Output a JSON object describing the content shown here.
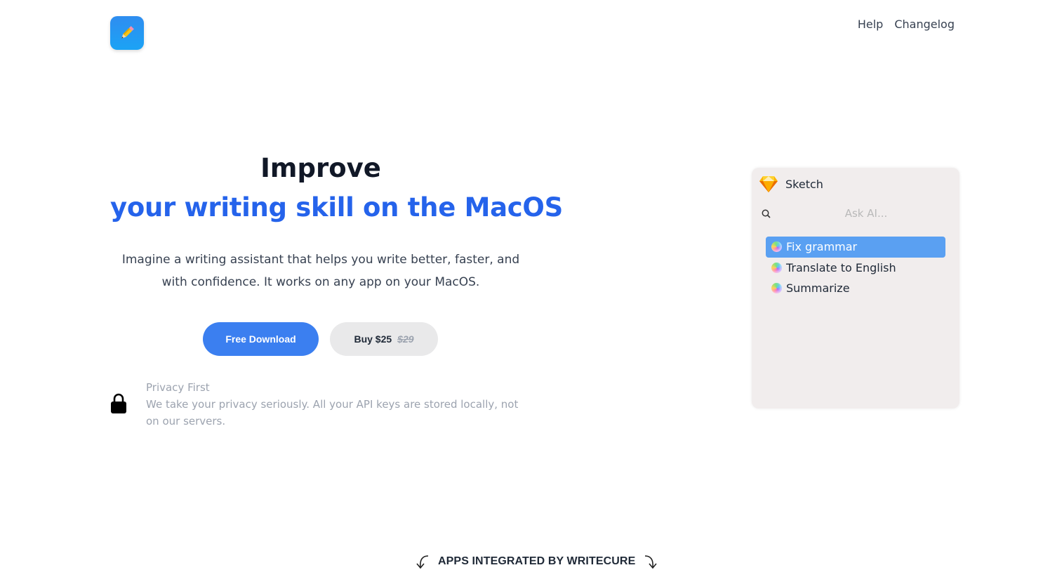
{
  "header": {
    "logo_icon": "pencil-icon",
    "nav": [
      {
        "label": "Help"
      },
      {
        "label": "Changelog"
      }
    ]
  },
  "hero": {
    "title": "Improve",
    "subtitle": "your writing skill on the MacOS",
    "description": "Imagine a writing assistant that helps you write better, faster, and with confidence. It works on any app on your MacOS.",
    "primary_button": "Free Download",
    "buy_button": {
      "label": "Buy $25",
      "old_price": "$29"
    }
  },
  "privacy": {
    "icon": "lock-icon",
    "title": "Privacy First",
    "text": "We take your privacy seriously. All your API keys are stored locally, not on our servers."
  },
  "panel": {
    "app_icon": "sketch-diamond-icon",
    "app_name": "Sketch",
    "search_placeholder": "Ask AI...",
    "items": [
      {
        "label": "Fix grammar",
        "active": true
      },
      {
        "label": "Translate to English",
        "active": false
      },
      {
        "label": "Summarize",
        "active": false
      }
    ]
  },
  "apps_section": {
    "caption": "APPS INTEGRATED BY WRITECURE"
  },
  "colors": {
    "accent": "#2563eb",
    "button_primary": "#3b7ff0",
    "panel_bg": "#f1eded",
    "highlight": "#5aa0f2"
  }
}
